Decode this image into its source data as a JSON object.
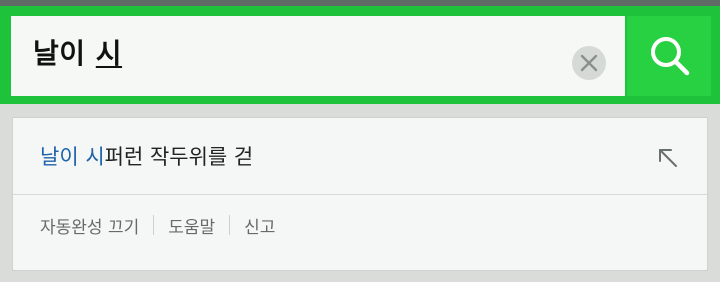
{
  "search": {
    "query_committed": "날이 ",
    "query_composing": "시",
    "clear_icon": "close-icon",
    "search_icon": "search-icon"
  },
  "suggestions": [
    {
      "highlight": "날이 시",
      "rest": "퍼런 작두위를 걷",
      "action_icon": "arrow-up-left-icon"
    }
  ],
  "footer": {
    "autocomplete_off": "자동완성 끄기",
    "help": "도움말",
    "report": "신고"
  },
  "colors": {
    "brand_green": "#1fc23b",
    "highlight_blue": "#1f63ab"
  }
}
